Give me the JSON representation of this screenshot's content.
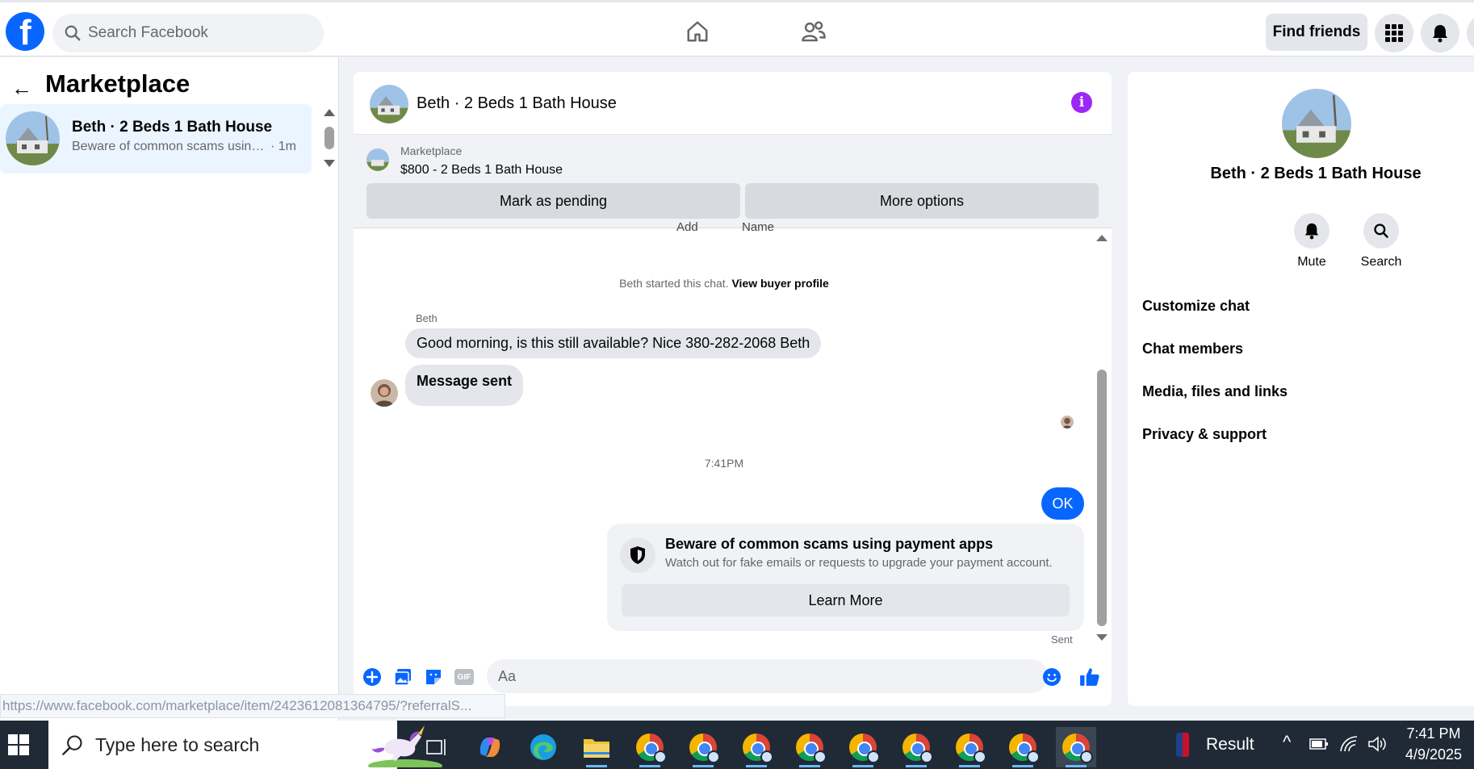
{
  "topbar": {
    "logo_letter": "f",
    "search_placeholder": "Search Facebook",
    "find_friends_label": "Find friends"
  },
  "left": {
    "title": "Marketplace",
    "conversations": [
      {
        "name": "Beth · 2 Beds 1 Bath House",
        "preview": "Beware of common scams using ...",
        "time": "· 1m"
      }
    ],
    "status_url": "https://www.facebook.com/marketplace/item/2423612081364795/?referralS..."
  },
  "chat": {
    "header_title": "Beth · 2 Beds 1 Bath House",
    "listing": {
      "source": "Marketplace",
      "price_title": "$800 - 2 Beds 1 Bath House",
      "mark_pending_label": "Mark as pending",
      "more_options_label": "More options"
    },
    "cutoff_add": "Add",
    "cutoff_name": "Name",
    "system_message": "Beth started this chat.",
    "system_link": "View buyer profile",
    "sender_name": "Beth",
    "incoming": [
      "Good morning, is this still available? Nice 380-282-2068 Beth",
      "Message sent"
    ],
    "timestamp": "7:41PM",
    "outgoing": "OK",
    "scam_notice": {
      "heading": "Beware of common scams using payment apps",
      "body": "Watch out for fake emails or requests to upgrade your payment account.",
      "button": "Learn More"
    },
    "sent_label": "Sent",
    "composer_placeholder": "Aa",
    "composer_icon_gif": "GIF"
  },
  "right": {
    "title": "Beth · 2 Beds 1 Bath House",
    "actions": [
      "Mute",
      "Search"
    ],
    "items": [
      "Customize chat",
      "Chat members",
      "Media, files and links",
      "Privacy & support"
    ]
  },
  "taskbar": {
    "search_placeholder": "Type here to search",
    "weather_label": "Result",
    "time": "7:41 PM",
    "date": "4/9/2025"
  },
  "colors": {
    "facebook_blue": "#0866ff",
    "info_purple": "#9c27f5",
    "selected_row": "#ebf5ff",
    "taskbar_bg": "#1f2a36"
  }
}
